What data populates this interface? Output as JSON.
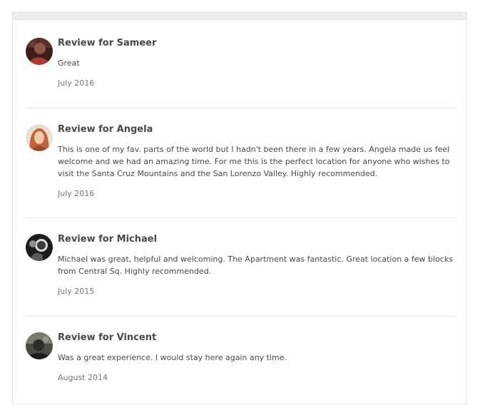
{
  "reviews": [
    {
      "title": "Review for Sameer",
      "text": "Great",
      "date": "July 2016",
      "avatar_icon": "person-photo-avatar"
    },
    {
      "title": "Review for Angela",
      "text": "This is one of my fav. parts of the world but I hadn't been there in a few years. Angela made us feel welcome and we had an amazing time. For me this is the perfect location for anyone who wishes to visit the Santa Cruz Mountains and the San Lorenzo Valley. Highly recommended.",
      "date": "July 2016",
      "avatar_icon": "person-photo-avatar"
    },
    {
      "title": "Review for Michael",
      "text": "Michael was great, helpful and welcoming. The Apartment was fantastic. Great location a few blocks from Central Sq. Highly recommended.",
      "date": "July 2015",
      "avatar_icon": "person-photo-avatar"
    },
    {
      "title": "Review for Vincent",
      "text": "Was a great experience. I would stay here again any time.",
      "date": "August 2014",
      "avatar_icon": "person-photo-avatar"
    }
  ]
}
